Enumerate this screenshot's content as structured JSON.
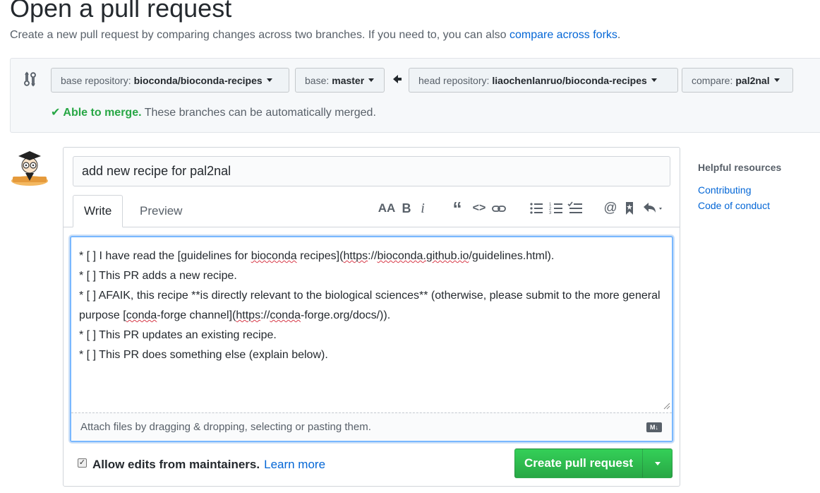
{
  "header": {
    "title": "Open a pull request",
    "subtitle_prefix": "Create a new pull request by comparing changes across two branches. If you need to, you can also ",
    "subtitle_link": "compare across forks",
    "subtitle_suffix": "."
  },
  "range": {
    "base_repo_label": "base repository:",
    "base_repo_value": "bioconda/bioconda-recipes",
    "base_label": "base:",
    "base_value": "master",
    "head_repo_label": "head repository:",
    "head_repo_value": "liaochenlanruo/bioconda-recipes",
    "compare_label": "compare:",
    "compare_value": "pal2nal",
    "merge_ok": "Able to merge.",
    "merge_msg": " These branches can be automatically merged."
  },
  "form": {
    "title_value": "add new recipe for pal2nal",
    "tab_write": "Write",
    "tab_preview": "Preview",
    "attach_hint": "Attach files by dragging & dropping, selecting or pasting them.",
    "markdown_badge": "M↓",
    "body_lines": [
      "* [ ] I have read the [guidelines for bioconda recipes](https://bioconda.github.io/guidelines.html).",
      "* [ ] This PR adds a new recipe.",
      "* [ ] AFAIK, this recipe **is directly relevant to the biological sciences** (otherwise, please submit to the more general purpose [conda-forge channel](https://conda-forge.org/docs/)).",
      "* [ ] This PR updates an existing recipe.",
      "* [ ] This PR does something else (explain below)."
    ],
    "allow_edits_label": "Allow edits from maintainers.",
    "learn_more": "Learn more",
    "create_button": "Create pull request"
  },
  "toolbar": {
    "icons": [
      "text-size-icon",
      "bold-icon",
      "italic-icon",
      "quote-icon",
      "code-icon",
      "link-icon",
      "bulleted-list-icon",
      "numbered-list-icon",
      "task-list-icon",
      "mention-icon",
      "saved-reply-icon",
      "reply-icon"
    ]
  },
  "sidebar": {
    "title": "Helpful resources",
    "links": [
      "Contributing",
      "Code of conduct"
    ]
  },
  "colors": {
    "accent": "#0366d6",
    "success": "#28a745",
    "focus_border": "#79b8ff"
  }
}
